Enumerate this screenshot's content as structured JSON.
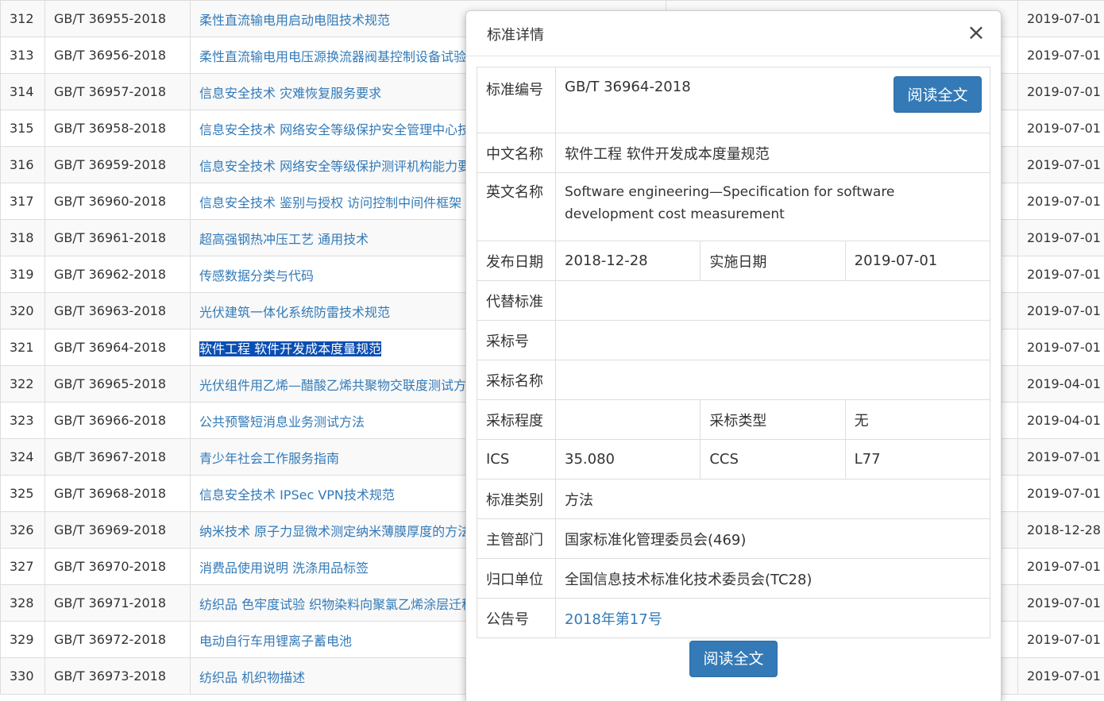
{
  "list": {
    "rows": [
      {
        "seq": "312",
        "code": "GB/T 36955-2018",
        "name": "柔性直流输电用启动电阻技术规范",
        "date": "2019-07-01"
      },
      {
        "seq": "313",
        "code": "GB/T 36956-2018",
        "name": "柔性直流输电用电压源换流器阀基控制设备试验",
        "date": "2019-07-01"
      },
      {
        "seq": "314",
        "code": "GB/T 36957-2018",
        "name": "信息安全技术 灾难恢复服务要求",
        "date": "2019-07-01"
      },
      {
        "seq": "315",
        "code": "GB/T 36958-2018",
        "name": "信息安全技术 网络安全等级保护安全管理中心技",
        "date": "2019-07-01"
      },
      {
        "seq": "316",
        "code": "GB/T 36959-2018",
        "name": "信息安全技术 网络安全等级保护测评机构能力要",
        "date": "2019-07-01"
      },
      {
        "seq": "317",
        "code": "GB/T 36960-2018",
        "name": "信息安全技术 鉴别与授权 访问控制中间件框架",
        "date": "2019-07-01"
      },
      {
        "seq": "318",
        "code": "GB/T 36961-2018",
        "name": "超高强钢热冲压工艺 通用技术",
        "date": "2019-07-01"
      },
      {
        "seq": "319",
        "code": "GB/T 36962-2018",
        "name": "传感数据分类与代码",
        "date": "2019-07-01"
      },
      {
        "seq": "320",
        "code": "GB/T 36963-2018",
        "name": "光伏建筑一体化系统防雷技术规范",
        "date": "2019-07-01"
      },
      {
        "seq": "321",
        "code": "GB/T 36964-2018",
        "name": "软件工程 软件开发成本度量规范",
        "date": "2019-07-01"
      },
      {
        "seq": "322",
        "code": "GB/T 36965-2018",
        "name": "光伏组件用乙烯—醋酸乙烯共聚物交联度测试方",
        "date": "2019-04-01"
      },
      {
        "seq": "323",
        "code": "GB/T 36966-2018",
        "name": "公共预警短消息业务测试方法",
        "date": "2019-04-01"
      },
      {
        "seq": "324",
        "code": "GB/T 36967-2018",
        "name": "青少年社会工作服务指南",
        "date": "2019-07-01"
      },
      {
        "seq": "325",
        "code": "GB/T 36968-2018",
        "name": "信息安全技术 IPSec VPN技术规范",
        "date": "2019-07-01"
      },
      {
        "seq": "326",
        "code": "GB/T 36969-2018",
        "name": "纳米技术 原子力显微术测定纳米薄膜厚度的方法",
        "date": "2018-12-28"
      },
      {
        "seq": "327",
        "code": "GB/T 36970-2018",
        "name": "消费品使用说明 洗涤用品标签",
        "date": "2019-07-01"
      },
      {
        "seq": "328",
        "code": "GB/T 36971-2018",
        "name": "纺织品 色牢度试验 织物染料向聚氯乙烯涂层迁移",
        "date": "2019-07-01"
      },
      {
        "seq": "329",
        "code": "GB/T 36972-2018",
        "name": "电动自行车用锂离子蓄电池",
        "date": "2019-07-01"
      },
      {
        "seq": "330",
        "code": "GB/T 36973-2018",
        "name": "纺织品 机织物描述",
        "date": "2019-07-01"
      }
    ]
  },
  "modal": {
    "title": "标准详情",
    "close_icon": "×",
    "read_button": "阅读全文",
    "fields": {
      "code_label": "标准编号",
      "code_value": "GB/T 36964-2018",
      "cn_name_label": "中文名称",
      "cn_name_value": "软件工程 软件开发成本度量规范",
      "en_name_label": "英文名称",
      "en_name_value": "Software engineering—Specification for software development cost measurement",
      "publish_label": "发布日期",
      "publish_value": "2018-12-28",
      "implement_label": "实施日期",
      "implement_value": "2019-07-01",
      "replace_label": "代替标准",
      "replace_value": "",
      "adopt_no_label": "采标号",
      "adopt_no_value": "",
      "adopt_name_label": "采标名称",
      "adopt_name_value": "",
      "adopt_degree_label": "采标程度",
      "adopt_degree_value": "",
      "adopt_type_label": "采标类型",
      "adopt_type_value": "无",
      "ics_label": "ICS",
      "ics_value": "35.080",
      "ccs_label": "CCS",
      "ccs_value": "L77",
      "category_label": "标准类别",
      "category_value": "方法",
      "dept_label": "主管部门",
      "dept_value": "国家标准化管理委员会(469)",
      "unit_label": "归口单位",
      "unit_value": "全国信息技术标准化技术委员会(TC28)",
      "notice_label": "公告号",
      "notice_value": "2018年第17号"
    }
  },
  "colors": {
    "link": "#337ab7",
    "button": "#337ab7",
    "selection": "#0b4eb3"
  }
}
